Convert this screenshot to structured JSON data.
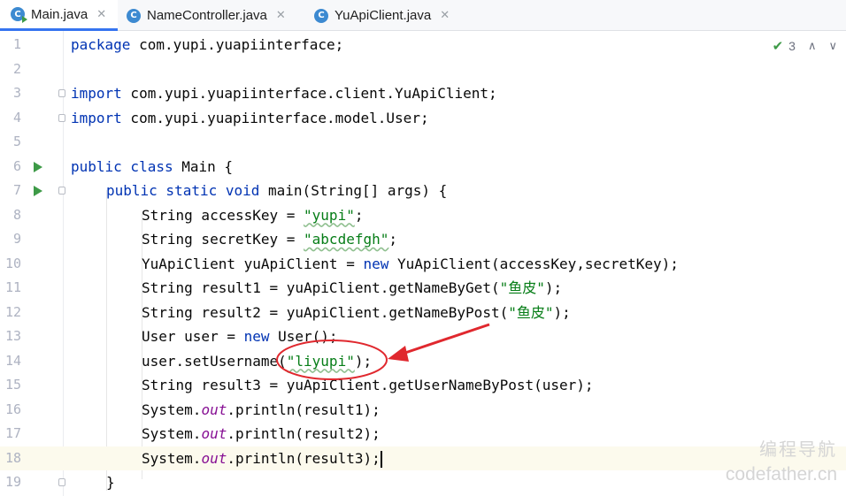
{
  "tabs": [
    {
      "label": "Main.java",
      "icon": "java-class-icon",
      "active": true
    },
    {
      "label": "NameController.java",
      "icon": "java-class-icon",
      "active": false
    },
    {
      "label": "YuApiClient.java",
      "icon": "java-class-icon",
      "active": false
    }
  ],
  "inspection": {
    "count": "3"
  },
  "lines": [
    "1",
    "2",
    "3",
    "4",
    "5",
    "6",
    "7",
    "8",
    "9",
    "10",
    "11",
    "12",
    "13",
    "14",
    "15",
    "16",
    "17",
    "18",
    "19"
  ],
  "code": {
    "l1": {
      "kw": "package",
      "rest": " com.yupi.yuapiinterface;"
    },
    "l3": {
      "kw": "import",
      "rest": " com.yupi.yuapiinterface.client.YuApiClient;"
    },
    "l4": {
      "kw": "import",
      "rest": " com.yupi.yuapiinterface.model.User;"
    },
    "l6": {
      "kw": "public class",
      "rest": " Main {"
    },
    "l7": {
      "kw": "public static void",
      "rest": " main(String[] args) {"
    },
    "l8": {
      "pre": "String accessKey = ",
      "str": "\"yupi\"",
      "post": ";"
    },
    "l9": {
      "pre": "String secretKey = ",
      "str": "\"abcdefgh\"",
      "post": ";"
    },
    "l10": {
      "pre": "YuApiClient yuApiClient = ",
      "kw": "new",
      "post": " YuApiClient(accessKey,secretKey);"
    },
    "l11": {
      "pre": "String result1 = yuApiClient.getNameByGet(",
      "str": "\"鱼皮\"",
      "post": ");"
    },
    "l12": {
      "pre": "String result2 = yuApiClient.getNameByPost(",
      "str": "\"鱼皮\"",
      "post": ");"
    },
    "l13": {
      "pre": "User user = ",
      "kw": "new",
      "post": " User();"
    },
    "l14": {
      "pre": "user.setUsername(",
      "str": "\"liyupi\"",
      "post": ");"
    },
    "l15": {
      "pre": "String result3 = yuApiClient.getUserNameByPost(user);"
    },
    "l16": {
      "pre": "System.",
      "fld": "out",
      "post": ".println(result1);"
    },
    "l17": {
      "pre": "System.",
      "fld": "out",
      "post": ".println(result2);"
    },
    "l18": {
      "pre": "System.",
      "fld": "out",
      "post": ".println(result3);"
    },
    "l19": {
      "pre": "}"
    }
  },
  "watermark": {
    "line1": "编程导航",
    "line2": "codefather.cn"
  },
  "colors": {
    "keyword": "#0033b3",
    "string": "#067d17",
    "field": "#871094",
    "annotation": "#e0282e",
    "run": "#3d9a47"
  }
}
